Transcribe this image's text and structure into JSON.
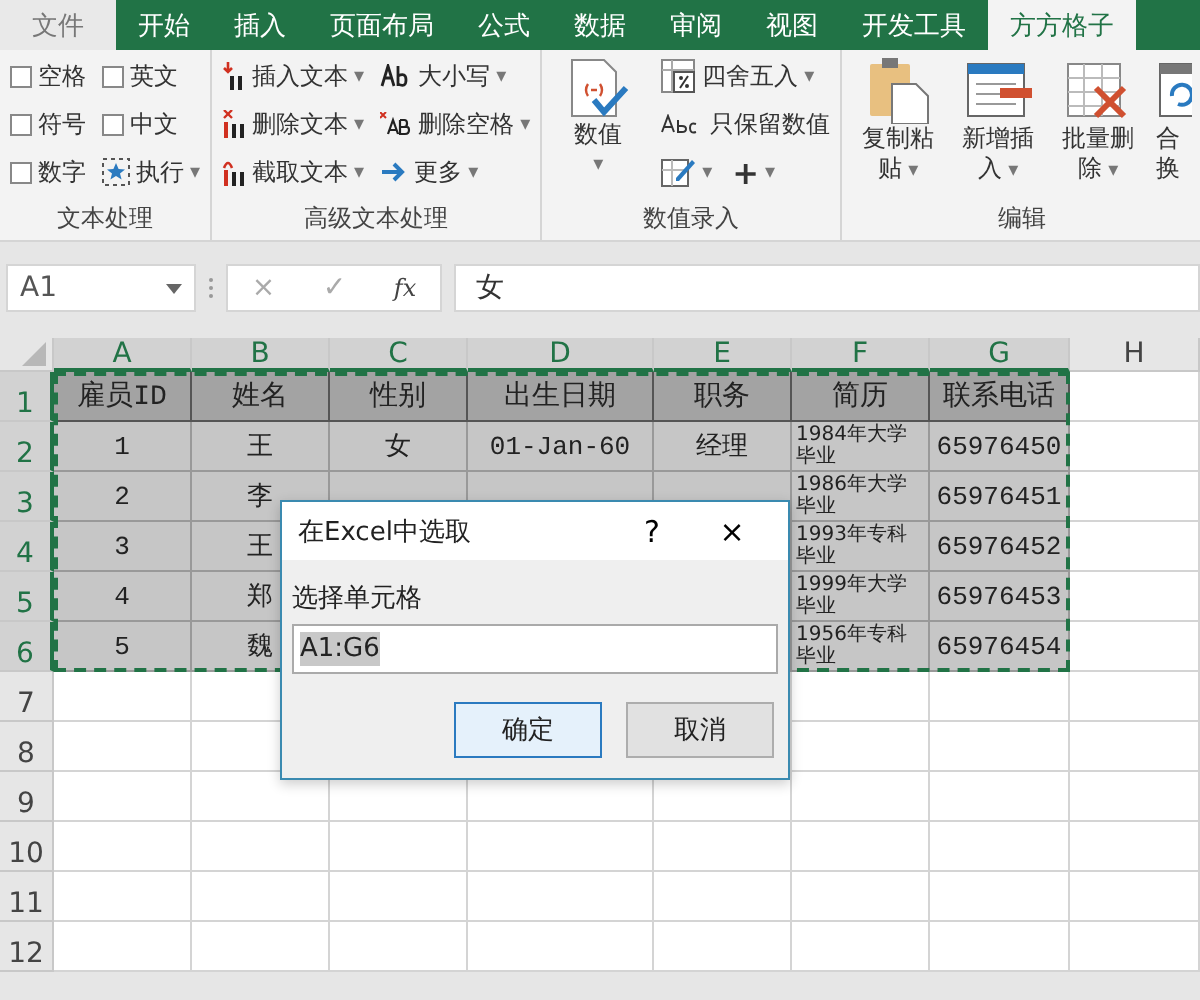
{
  "tabs": [
    {
      "label": "文件",
      "kind": "file",
      "selected": false
    },
    {
      "label": "开始",
      "kind": "tab",
      "selected": false
    },
    {
      "label": "插入",
      "kind": "tab",
      "selected": false
    },
    {
      "label": "页面布局",
      "kind": "tab",
      "selected": false
    },
    {
      "label": "公式",
      "kind": "tab",
      "selected": false
    },
    {
      "label": "数据",
      "kind": "tab",
      "selected": false
    },
    {
      "label": "审阅",
      "kind": "tab",
      "selected": false
    },
    {
      "label": "视图",
      "kind": "tab",
      "selected": false
    },
    {
      "label": "开发工具",
      "kind": "tab",
      "selected": false
    },
    {
      "label": "方方格子",
      "kind": "tab",
      "selected": true
    }
  ],
  "ribbon": {
    "groups": [
      {
        "label": "文本处理",
        "kind": "checks",
        "columns": [
          [
            {
              "label": "空格",
              "checked": false
            },
            {
              "label": "符号",
              "checked": false
            },
            {
              "label": "数字",
              "checked": false
            }
          ],
          [
            {
              "label": "英文",
              "checked": false
            },
            {
              "label": "中文",
              "checked": false
            }
          ]
        ],
        "run_button": {
          "label": "执行",
          "caret": "▾"
        }
      },
      {
        "label": "高级文本处理",
        "kind": "commands",
        "columns": [
          [
            {
              "label": "插入文本",
              "caret": "▾"
            },
            {
              "label": "删除文本",
              "caret": "▾"
            },
            {
              "label": "截取文本",
              "caret": "▾"
            }
          ],
          [
            {
              "label": "大小写",
              "caret": "▾"
            },
            {
              "label": "删除空格",
              "caret": "▾"
            },
            {
              "label": "更多",
              "caret": "▾"
            }
          ]
        ]
      },
      {
        "label": "数值录入",
        "kind": "numbers",
        "big": {
          "label": "数值",
          "caret": "▾"
        },
        "items": [
          {
            "label": "四舍五入",
            "caret": "▾"
          },
          {
            "label": "只保留数值"
          }
        ],
        "small": [
          {
            "kind": "icon",
            "caret": "▾"
          },
          {
            "kind": "text",
            "label": "+",
            "caret": "▾"
          }
        ]
      },
      {
        "label": "编辑",
        "kind": "bigs",
        "buttons": [
          {
            "lines": [
              "复制粘",
              "贴"
            ],
            "caret": "▾"
          },
          {
            "lines": [
              "新增插",
              "入"
            ],
            "caret": "▾"
          },
          {
            "lines": [
              "批量删",
              "除"
            ],
            "caret": "▾"
          },
          {
            "lines": [
              "合",
              "换"
            ]
          }
        ]
      }
    ]
  },
  "formula_bar": {
    "name_box": "A1",
    "cancel": "×",
    "enter": "✓",
    "function": "fx",
    "value": "女"
  },
  "sheet": {
    "columns": [
      "A",
      "B",
      "C",
      "D",
      "E",
      "F",
      "G",
      "H"
    ],
    "row_numbers": [
      "1",
      "2",
      "3",
      "4",
      "5",
      "6",
      "7",
      "8",
      "9",
      "10",
      "11",
      "12"
    ],
    "header": [
      "雇员ID",
      "姓名",
      "性别",
      "出生日期",
      "职务",
      "简历",
      "联系电话"
    ],
    "rows": [
      {
        "id": "1",
        "name": "王",
        "gender": "女",
        "birth": "01-Jan-60",
        "title": "经理",
        "resume": "1984年大学毕业",
        "phone": "65976450"
      },
      {
        "id": "2",
        "name": "李",
        "resume": "1986年大学毕业",
        "phone": "65976451"
      },
      {
        "id": "3",
        "name": "王",
        "resume": "1993年专科毕业",
        "phone": "65976452"
      },
      {
        "id": "4",
        "name": "郑",
        "resume": "1999年大学毕业",
        "phone": "65976453"
      },
      {
        "id": "5",
        "name": "魏",
        "resume": "1956年专科毕业",
        "phone": "65976454"
      }
    ]
  },
  "dialog": {
    "title": "在Excel中选取",
    "help": "?",
    "close": "×",
    "label": "选择单元格",
    "value": "A1:G6",
    "buttons": [
      {
        "label": "确定",
        "focused": true
      },
      {
        "label": "取消",
        "focused": false
      }
    ]
  }
}
